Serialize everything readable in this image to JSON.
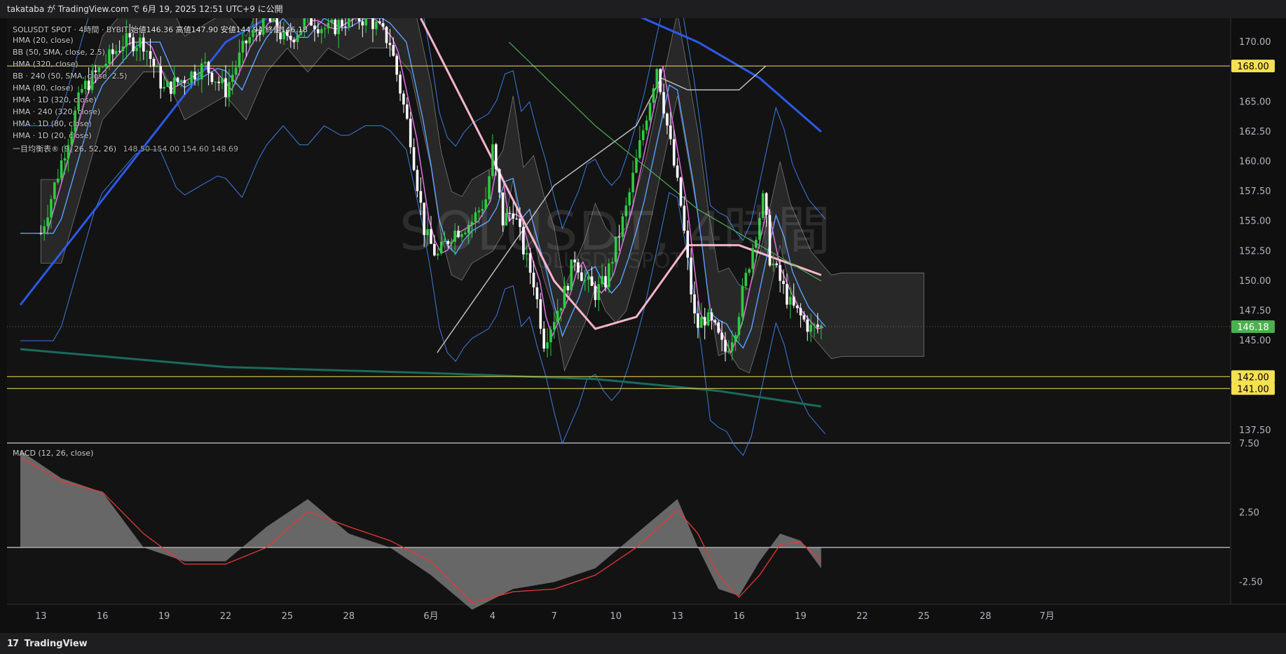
{
  "header": {
    "published_text": "takataba が TradingView.com で 6月 19, 2025 12:51 UTC+9 に公開"
  },
  "watermark": {
    "symbol_text": "SOLUSDT, 4時間",
    "sub_text": "SOLUSDT SPOT"
  },
  "legend": {
    "main": "SOLUSDT SPOT · 4時間 · BYBIT",
    "ohlc": "始値146.36  高値147.90  安値144.94  終値146.18",
    "indicators": [
      "HMA (20, close)",
      "BB (50, SMA, close, 2.5)",
      "HMA (320, close)",
      "BB · 240 (50, SMA, close, 2.5)",
      "HMA (80, close)",
      "HMA · 1D (320, close)",
      "HMA · 240 (320, close)",
      "HMA · 1D (80, close)",
      "HMA · 1D (20, close)"
    ],
    "ichimoku": "一目均衡表® (9, 26, 52, 26)",
    "ichimoku_values": "148.50  154.00  154.60  148.69"
  },
  "macd_label": "MACD (12, 26, close)",
  "footer": {
    "logo_text": "TradingView",
    "logo_mark": "17"
  },
  "colors": {
    "up": "#2ecc40",
    "down": "#ffffff",
    "level_line": "#f5e050",
    "price_tag": "#4caf50",
    "hma_blue": "#2c5ae8",
    "hma_pink": "#f7b6c9",
    "hma_teal": "#1a6b5a",
    "macd_signal": "#e53935"
  },
  "chart_data": [
    {
      "type": "candlestick",
      "symbol": "SOLUSDT",
      "timeframe": "4時間",
      "y_ticks": [
        "170.00",
        "165.00",
        "162.50",
        "160.00",
        "157.50",
        "155.00",
        "152.50",
        "150.00",
        "147.50",
        "145.00",
        "137.50"
      ],
      "x_ticks": [
        "13",
        "16",
        "19",
        "22",
        "25",
        "28",
        "6月",
        "4",
        "7",
        "10",
        "13",
        "16",
        "19",
        "22",
        "25",
        "28",
        "7月"
      ],
      "x_tick_days": [
        -19,
        -16,
        -13,
        -10,
        -7,
        -4,
        0,
        3,
        6,
        9,
        12,
        15,
        18,
        21,
        24,
        27,
        30
      ],
      "ylim": [
        136.5,
        172
      ],
      "horizontal_levels": [
        168.0,
        142.0,
        141.0
      ],
      "last_price": 146.18,
      "price_path": [
        [
          -19,
          154
        ],
        [
          -18,
          160
        ],
        [
          -17,
          166
        ],
        [
          -16,
          168
        ],
        [
          -15,
          170
        ],
        [
          -14,
          170
        ],
        [
          -13,
          166
        ],
        [
          -12,
          167
        ],
        [
          -11,
          168
        ],
        [
          -10,
          166
        ],
        [
          -9,
          170
        ],
        [
          -8,
          172
        ],
        [
          -7,
          170
        ],
        [
          -6,
          172
        ],
        [
          -5,
          171
        ],
        [
          -4,
          172
        ],
        [
          -3,
          172
        ],
        [
          -2,
          170
        ],
        [
          -1,
          162
        ],
        [
          -0.3,
          154
        ],
        [
          0.3,
          152
        ],
        [
          1,
          154
        ],
        [
          2,
          155
        ],
        [
          2.7,
          157
        ],
        [
          3,
          161
        ],
        [
          3.5,
          155
        ],
        [
          4,
          156
        ],
        [
          4.6,
          152
        ],
        [
          5,
          150
        ],
        [
          5.5,
          145
        ],
        [
          6,
          147
        ],
        [
          6.5,
          149
        ],
        [
          7,
          152
        ],
        [
          7.5,
          150
        ],
        [
          8,
          149
        ],
        [
          8.5,
          150
        ],
        [
          9,
          153
        ],
        [
          9.5,
          156
        ],
        [
          10,
          160
        ],
        [
          10.5,
          164
        ],
        [
          11,
          168
        ],
        [
          11.4,
          164
        ],
        [
          11.8,
          160
        ],
        [
          12.2,
          156
        ],
        [
          12.6,
          150
        ],
        [
          12.9,
          146
        ],
        [
          13.3,
          147
        ],
        [
          13.8,
          146
        ],
        [
          14.3,
          144
        ],
        [
          14.8,
          146
        ],
        [
          15.3,
          150
        ],
        [
          15.8,
          154
        ],
        [
          16.2,
          157
        ],
        [
          16.5,
          152
        ],
        [
          17,
          150
        ],
        [
          17.5,
          148
        ],
        [
          18,
          147
        ],
        [
          18.5,
          146
        ],
        [
          19,
          146.18
        ]
      ],
      "macd_y_ticks": [
        "7.50",
        "2.50",
        "-2.50"
      ],
      "macd_ylim": [
        -4,
        7.5
      ],
      "macd": {
        "x": [
          -20,
          -18,
          -16,
          -14,
          -12,
          -10,
          -8,
          -6,
          -4,
          -2,
          0,
          2,
          4,
          6,
          8,
          10,
          12,
          13,
          14,
          15,
          16,
          17,
          18,
          19
        ],
        "macd": [
          7,
          5,
          4,
          0,
          -1,
          -1,
          1.5,
          3.5,
          1,
          0,
          -2,
          -4.5,
          -3,
          -2.5,
          -1.5,
          1,
          3.5,
          0,
          -3,
          -3.5,
          -1,
          1,
          0.5,
          -1.5
        ],
        "signal": [
          6.5,
          4.8,
          4,
          1,
          -1.2,
          -1.2,
          0,
          2.6,
          1.5,
          0.5,
          -1,
          -4,
          -3.2,
          -3,
          -2,
          0,
          2.7,
          1,
          -2,
          -3.6,
          -2,
          0.2,
          0.4,
          -1
        ]
      }
    }
  ]
}
